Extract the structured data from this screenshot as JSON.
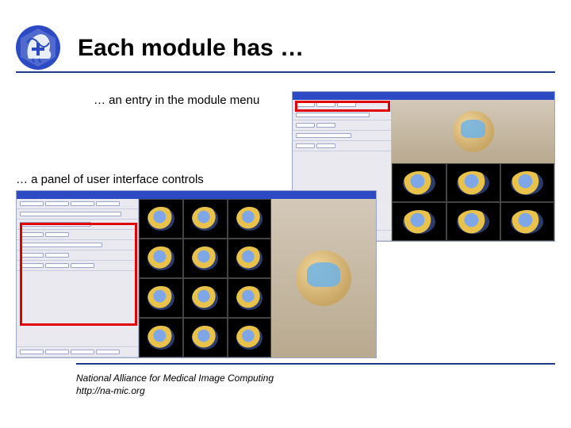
{
  "title": "Each module has …",
  "captions": {
    "menu_entry": "… an entry in the module menu",
    "ui_panel": "… a panel of user interface controls"
  },
  "footer": {
    "org": "National Alliance for Medical Image Computing",
    "url": "http://na-mic.org"
  },
  "colors": {
    "rule": "#203a8a",
    "highlight": "#e00000"
  }
}
